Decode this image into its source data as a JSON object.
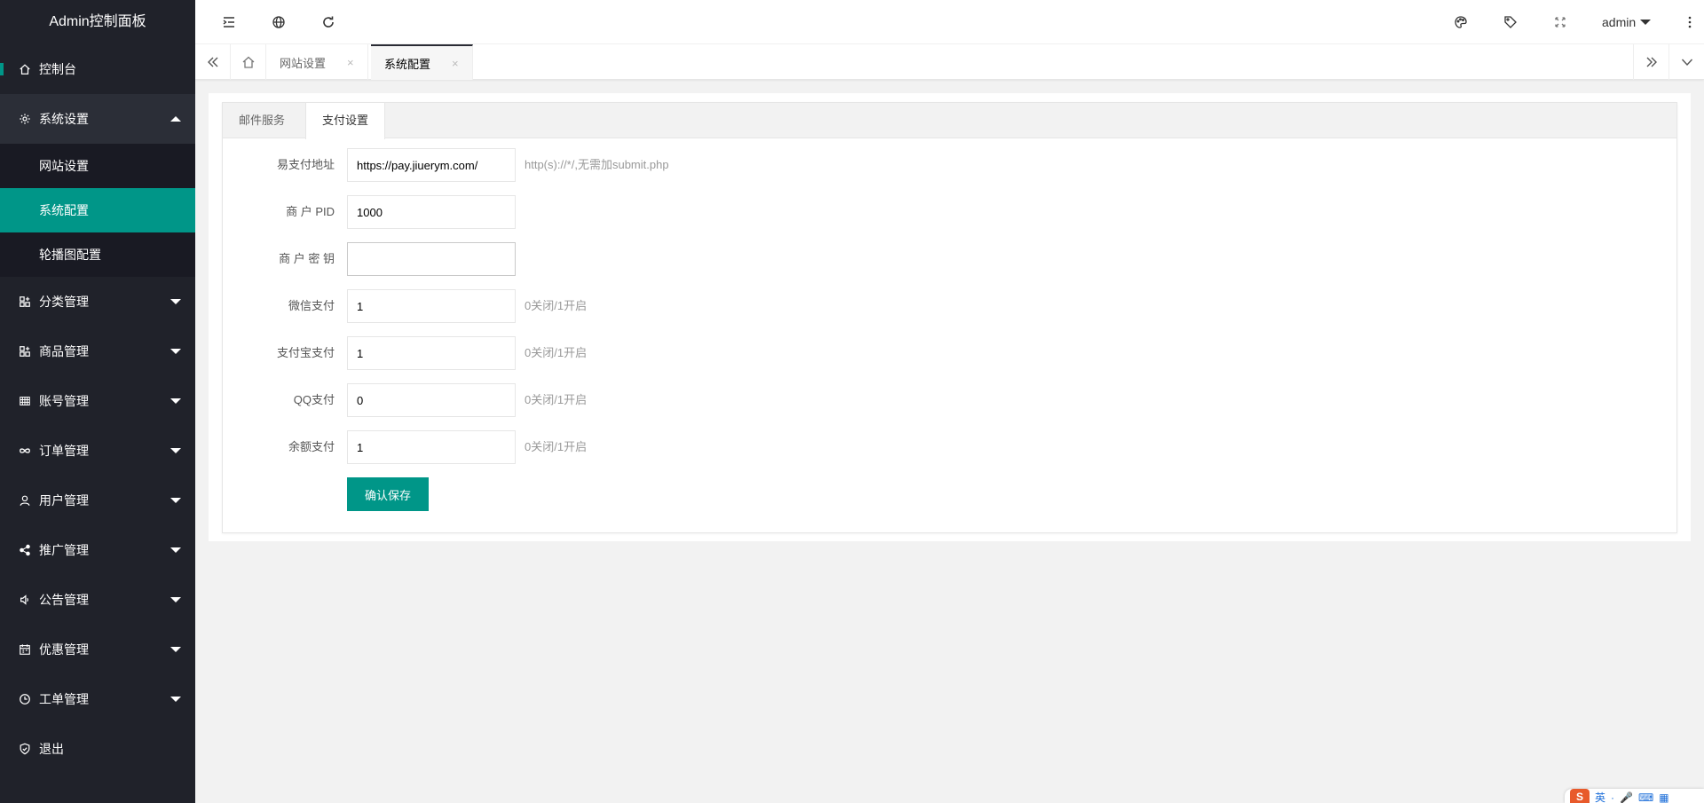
{
  "app": {
    "title": "Admin控制面板"
  },
  "sidebar": {
    "items": [
      {
        "label": "控制台",
        "icon": "home-icon"
      },
      {
        "label": "系统设置",
        "icon": "gear-icon",
        "expanded": true,
        "children": [
          {
            "label": "网站设置"
          },
          {
            "label": "系统配置",
            "active": true
          },
          {
            "label": "轮播图配置"
          }
        ]
      },
      {
        "label": "分类管理",
        "icon": "app-add-icon"
      },
      {
        "label": "商品管理",
        "icon": "app-add-icon"
      },
      {
        "label": "账号管理",
        "icon": "table-icon"
      },
      {
        "label": "订单管理",
        "icon": "infinity-icon"
      },
      {
        "label": "用户管理",
        "icon": "user-icon"
      },
      {
        "label": "推广管理",
        "icon": "share-icon"
      },
      {
        "label": "公告管理",
        "icon": "speaker-icon"
      },
      {
        "label": "优惠管理",
        "icon": "calendar-icon"
      },
      {
        "label": "工单管理",
        "icon": "clock-icon"
      },
      {
        "label": "退出",
        "icon": "shield-icon"
      }
    ]
  },
  "header": {
    "icons": [
      "menu-indent-icon",
      "globe-icon",
      "refresh-icon",
      "palette-icon",
      "tag-icon",
      "fullscreen-icon",
      "more-vertical-icon"
    ],
    "user": "admin"
  },
  "page_tabs": [
    {
      "label": "网站设置",
      "close": "×"
    },
    {
      "label": "系统配置",
      "close": "×",
      "active": true
    }
  ],
  "settings": {
    "tabs": [
      {
        "label": "邮件服务"
      },
      {
        "label": "支付设置",
        "active": true
      }
    ],
    "fields": [
      {
        "label": "易支付地址",
        "value": "https://pay.jiuerym.com/",
        "hint": "http(s)://*/,无需加submit.php"
      },
      {
        "label": "商 户 PID",
        "value": "1000",
        "hint": ""
      },
      {
        "label": "商 户 密 钥",
        "value": "",
        "hint": ""
      },
      {
        "label": "微信支付",
        "value": "1",
        "hint": "0关闭/1开启"
      },
      {
        "label": "支付宝支付",
        "value": "1",
        "hint": "0关闭/1开启"
      },
      {
        "label": "QQ支付",
        "value": "0",
        "hint": "0关闭/1开启"
      },
      {
        "label": "余额支付",
        "value": "1",
        "hint": "0关闭/1开启"
      }
    ],
    "save_label": "确认保存"
  },
  "ime": {
    "logo": "S",
    "mode": "英",
    "punct": "·",
    "mic": "🎤",
    "keyboard": "⌨",
    "grid": "▦"
  },
  "colors": {
    "accent": "#009688",
    "sidebar_bg": "#20222a",
    "submenu_bg": "#191a23"
  }
}
